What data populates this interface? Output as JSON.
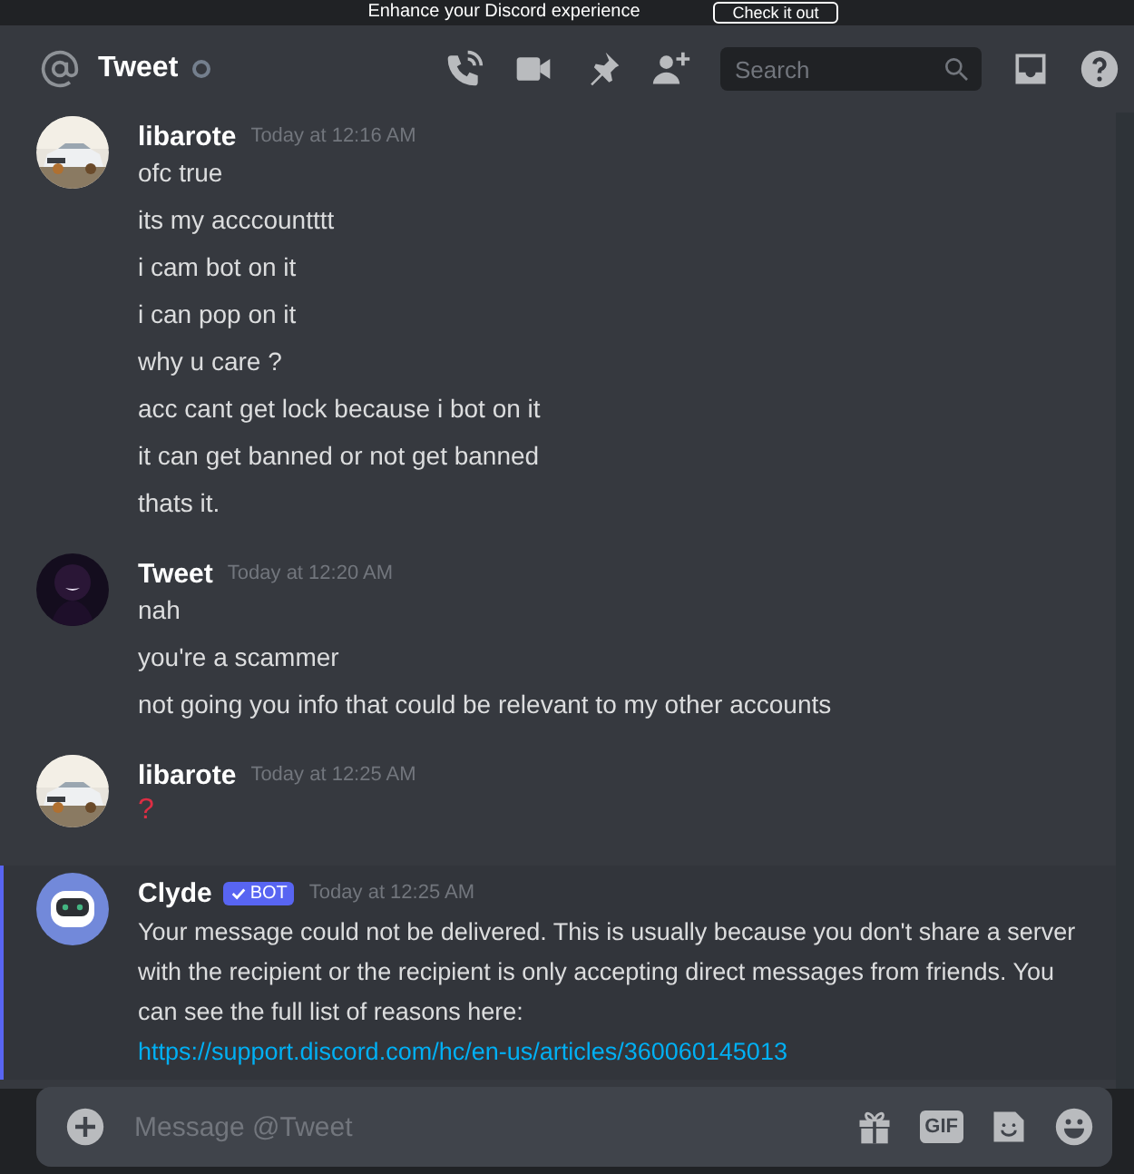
{
  "banner": {
    "text": "Enhance your Discord experience",
    "button": "Check it out"
  },
  "header": {
    "channel_name": "Tweet",
    "online": false,
    "search": {
      "placeholder": "Search"
    }
  },
  "messages": [
    {
      "author": "libarote",
      "timestamp": "Today at 12:16 AM",
      "avatar": {
        "kind": "picture"
      },
      "highlighted": false,
      "lines": [
        {
          "kind": "text",
          "text": "ofc true"
        },
        {
          "kind": "text",
          "text": "its my acccountttt"
        },
        {
          "kind": "text",
          "text": "i cam bot on it"
        },
        {
          "kind": "text",
          "text": "i can pop on it"
        },
        {
          "kind": "text",
          "text": "why u care ?"
        },
        {
          "kind": "text",
          "text": "acc cant get lock because i bot on it"
        },
        {
          "kind": "text",
          "text": "it can get banned or not get banned"
        },
        {
          "kind": "text",
          "text": "thats it."
        }
      ]
    },
    {
      "author": "Tweet",
      "timestamp": "Today at 12:20 AM",
      "avatar": {
        "kind": "picture"
      },
      "highlighted": false,
      "lines": [
        {
          "kind": "text",
          "text": "nah"
        },
        {
          "kind": "text",
          "text": "you're a scammer"
        },
        {
          "kind": "text",
          "text": "not going you info that could be relevant to my other accounts"
        }
      ]
    },
    {
      "author": "libarote",
      "timestamp": "Today at 12:25 AM",
      "avatar": {
        "kind": "picture"
      },
      "highlighted": false,
      "lines": [
        {
          "kind": "emoji",
          "text": "?"
        }
      ]
    },
    {
      "author": "Clyde",
      "tag": "BOT",
      "timestamp": "Today at 12:25 AM",
      "avatar": {
        "kind": "bot"
      },
      "highlighted": true,
      "lines": [
        {
          "kind": "paragraph",
          "text": "Your message could not be delivered. This is usually because you don't share a server with the recipient or the recipient is only accepting direct messages from friends. You can see the full list of reasons here:"
        },
        {
          "kind": "link",
          "text": "https://support.discord.com/hc/en-us/articles/360060145013"
        }
      ]
    }
  ],
  "composer": {
    "placeholder": "Message @Tweet",
    "gif_button": "GIF"
  }
}
